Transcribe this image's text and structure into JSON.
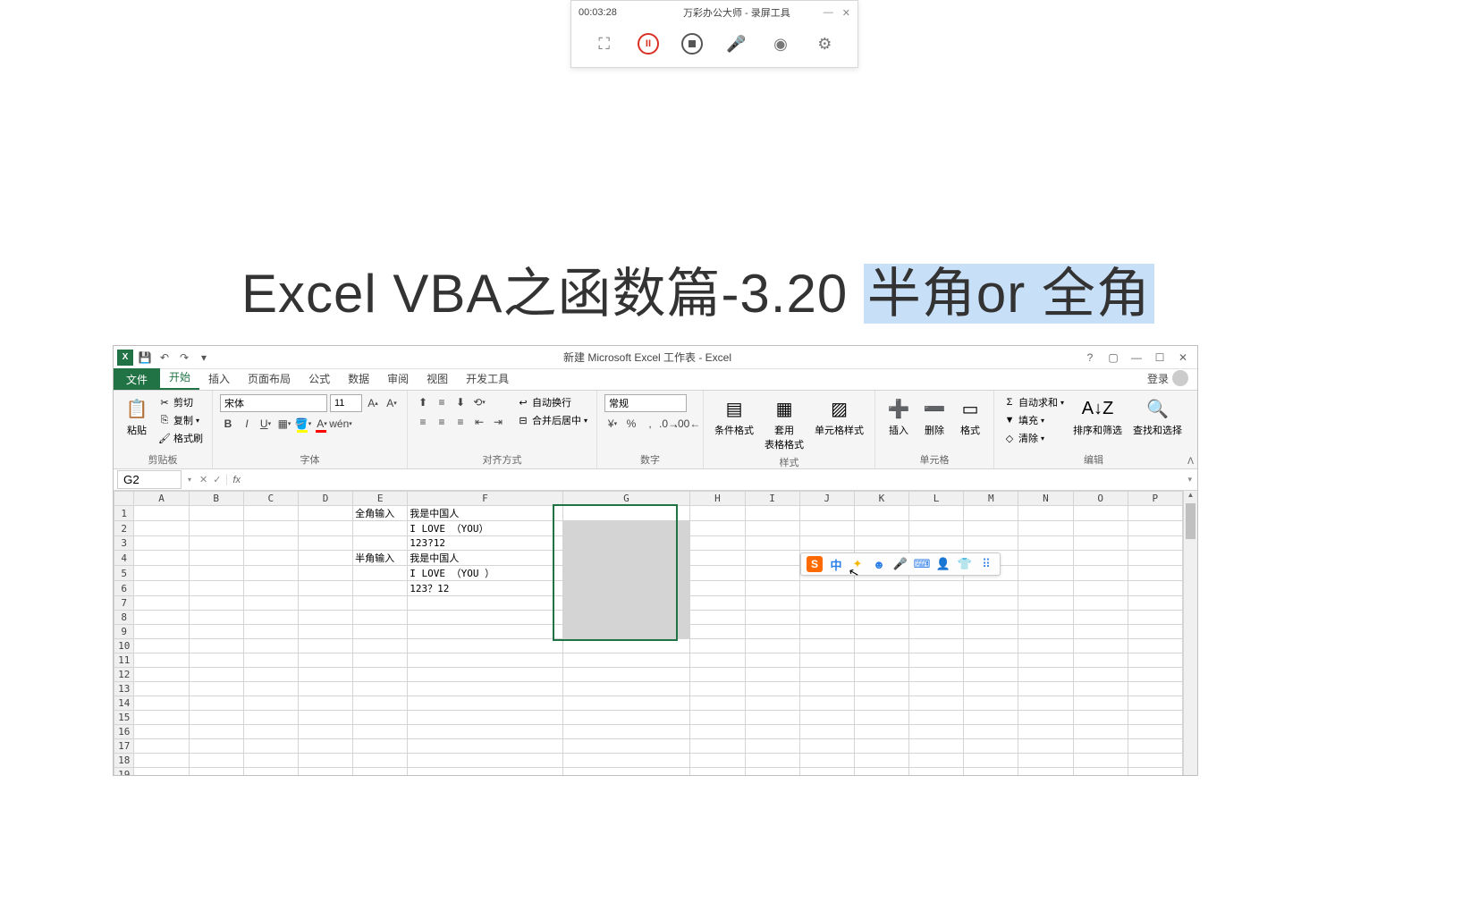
{
  "recorder": {
    "time": "00:03:28",
    "title": "万彩办公大师 - 录屏工具",
    "minimize": "—",
    "close": "✕"
  },
  "page_title": {
    "prefix": "Excel VBA之函数篇-3.20 ",
    "highlight": "半角or 全角"
  },
  "excel": {
    "title": "新建 Microsoft Excel 工作表 - Excel",
    "help": "?",
    "login": "登录",
    "tabs": {
      "file": "文件",
      "home": "开始",
      "insert": "插入",
      "layout": "页面布局",
      "formula": "公式",
      "data": "数据",
      "review": "审阅",
      "view": "视图",
      "dev": "开发工具"
    },
    "ribbon": {
      "clipboard": {
        "label": "剪贴板",
        "paste": "粘贴",
        "cut": "剪切",
        "copy": "复制",
        "painter": "格式刷"
      },
      "font": {
        "label": "字体",
        "name": "宋体",
        "size": "11"
      },
      "align": {
        "label": "对齐方式",
        "wrap": "自动换行",
        "merge": "合并后居中"
      },
      "number": {
        "label": "数字",
        "format": "常规"
      },
      "styles": {
        "label": "样式",
        "cond": "条件格式",
        "table": "套用\n表格格式",
        "cell": "单元格样式"
      },
      "cells": {
        "label": "单元格",
        "insert": "插入",
        "delete": "删除",
        "format": "格式"
      },
      "editing": {
        "label": "编辑",
        "sum": "自动求和",
        "fill": "填充",
        "clear": "清除",
        "sort": "排序和筛选",
        "find": "查找和选择"
      }
    },
    "namebox": "G2",
    "columns": [
      "A",
      "B",
      "C",
      "D",
      "E",
      "F",
      "G",
      "H",
      "I",
      "J",
      "K",
      "L",
      "M",
      "N",
      "O",
      "P"
    ],
    "rows": 20,
    "cells": {
      "E1": "全角输入",
      "F1": "我是中国人",
      "F2": "I LOVE （YOU）",
      "F3": "123?12",
      "E4": "半角输入",
      "F4": "我是中国人",
      "F5": "I LOVE （YOU ）",
      "F6": "123？12"
    },
    "selection": {
      "col": "G",
      "startRow": 1,
      "endRow": 9
    }
  },
  "ime": {
    "zhong": "中"
  }
}
